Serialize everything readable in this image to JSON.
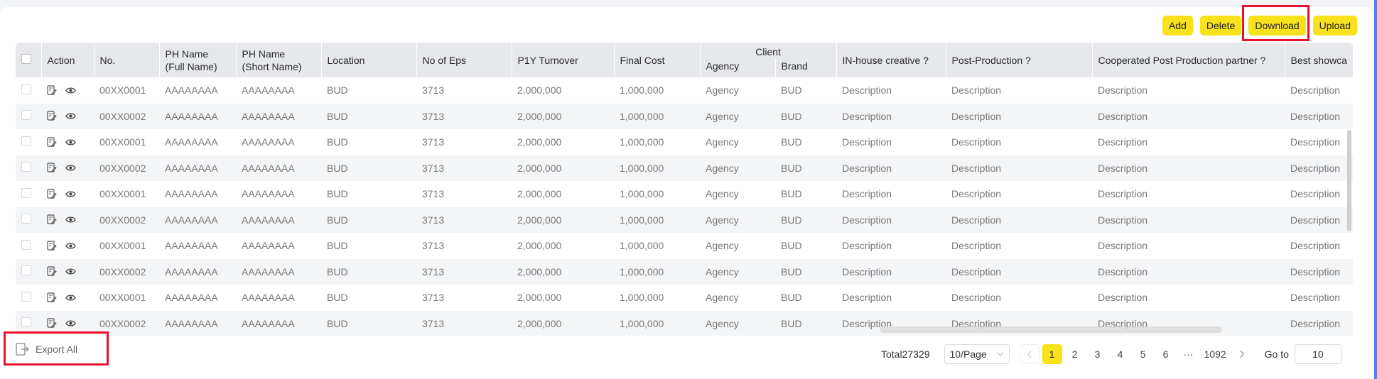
{
  "toolbar": {
    "add_label": "Add",
    "delete_label": "Delete",
    "download_label": "Download",
    "upload_label": "Upload"
  },
  "table": {
    "headers": {
      "action": "Action",
      "no": "No.",
      "ph_full_1": "PH Name",
      "ph_full_2": "(Full Name)",
      "ph_short_1": "PH Name",
      "ph_short_2": "(Short Name)",
      "location": "Location",
      "eps": "No of Eps",
      "turnover": "P1Y Turnover",
      "final_cost": "Final Cost",
      "client": "Client",
      "agency": "Agency",
      "brand": "Brand",
      "inhouse": "IN-house creative ?",
      "post": "Post-Production ?",
      "partner": "Cooperated Post Production partner ?",
      "showcase": "Best showca"
    },
    "rows": [
      {
        "no": "00XX0001",
        "full": "AAAAAAAA",
        "short": "AAAAAAAA",
        "loc": "BUD",
        "eps": "3713",
        "turnover": "2,000,000",
        "cost": "1,000,000",
        "agency": "Agency",
        "brand": "BUD",
        "inhouse": "Description",
        "post": "Description",
        "partner": "Description",
        "showcase": "Description"
      },
      {
        "no": "00XX0002",
        "full": "AAAAAAAA",
        "short": "AAAAAAAA",
        "loc": "BUD",
        "eps": "3713",
        "turnover": "2,000,000",
        "cost": "1,000,000",
        "agency": "Agency",
        "brand": "BUD",
        "inhouse": "Description",
        "post": "Description",
        "partner": "Description",
        "showcase": "Description"
      },
      {
        "no": "00XX0001",
        "full": "AAAAAAAA",
        "short": "AAAAAAAA",
        "loc": "BUD",
        "eps": "3713",
        "turnover": "2,000,000",
        "cost": "1,000,000",
        "agency": "Agency",
        "brand": "BUD",
        "inhouse": "Description",
        "post": "Description",
        "partner": "Description",
        "showcase": "Description"
      },
      {
        "no": "00XX0002",
        "full": "AAAAAAAA",
        "short": "AAAAAAAA",
        "loc": "BUD",
        "eps": "3713",
        "turnover": "2,000,000",
        "cost": "1,000,000",
        "agency": "Agency",
        "brand": "BUD",
        "inhouse": "Description",
        "post": "Description",
        "partner": "Description",
        "showcase": "Description"
      },
      {
        "no": "00XX0001",
        "full": "AAAAAAAA",
        "short": "AAAAAAAA",
        "loc": "BUD",
        "eps": "3713",
        "turnover": "2,000,000",
        "cost": "1,000,000",
        "agency": "Agency",
        "brand": "BUD",
        "inhouse": "Description",
        "post": "Description",
        "partner": "Description",
        "showcase": "Description"
      },
      {
        "no": "00XX0002",
        "full": "AAAAAAAA",
        "short": "AAAAAAAA",
        "loc": "BUD",
        "eps": "3713",
        "turnover": "2,000,000",
        "cost": "1,000,000",
        "agency": "Agency",
        "brand": "BUD",
        "inhouse": "Description",
        "post": "Description",
        "partner": "Description",
        "showcase": "Description"
      },
      {
        "no": "00XX0001",
        "full": "AAAAAAAA",
        "short": "AAAAAAAA",
        "loc": "BUD",
        "eps": "3713",
        "turnover": "2,000,000",
        "cost": "1,000,000",
        "agency": "Agency",
        "brand": "BUD",
        "inhouse": "Description",
        "post": "Description",
        "partner": "Description",
        "showcase": "Description"
      },
      {
        "no": "00XX0002",
        "full": "AAAAAAAA",
        "short": "AAAAAAAA",
        "loc": "BUD",
        "eps": "3713",
        "turnover": "2,000,000",
        "cost": "1,000,000",
        "agency": "Agency",
        "brand": "BUD",
        "inhouse": "Description",
        "post": "Description",
        "partner": "Description",
        "showcase": "Description"
      },
      {
        "no": "00XX0001",
        "full": "AAAAAAAA",
        "short": "AAAAAAAA",
        "loc": "BUD",
        "eps": "3713",
        "turnover": "2,000,000",
        "cost": "1,000,000",
        "agency": "Agency",
        "brand": "BUD",
        "inhouse": "Description",
        "post": "Description",
        "partner": "Description",
        "showcase": "Description"
      },
      {
        "no": "00XX0002",
        "full": "AAAAAAAA",
        "short": "AAAAAAAA",
        "loc": "BUD",
        "eps": "3713",
        "turnover": "2,000,000",
        "cost": "1,000,000",
        "agency": "Agency",
        "brand": "BUD",
        "inhouse": "Description",
        "post": "Description",
        "partner": "Description",
        "showcase": "Description"
      }
    ]
  },
  "footer": {
    "export_label": "Export All",
    "total": "Total27329",
    "page_size": "10/Page",
    "pages": [
      "1",
      "2",
      "3",
      "4",
      "5",
      "6"
    ],
    "ellipsis": "···",
    "last_page": "1092",
    "goto_label": "Go to",
    "goto_value": "10"
  },
  "colors": {
    "accent": "#f7e21b",
    "highlight": "#e8112d"
  }
}
